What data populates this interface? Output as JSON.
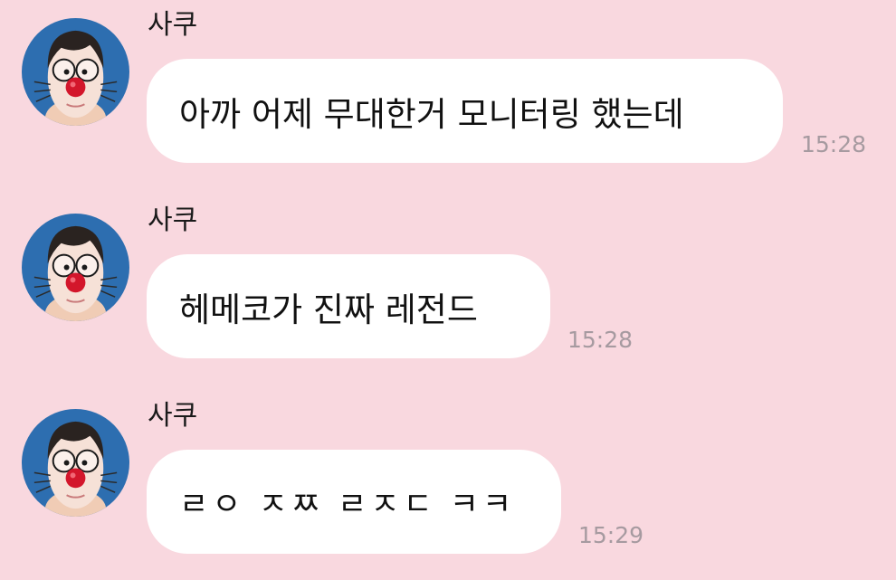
{
  "messages": [
    {
      "sender": "사쿠",
      "text": "아까 어제 무대한거 모니터링 했는데",
      "time": "15:28"
    },
    {
      "sender": "사쿠",
      "text": "헤메코가 진짜 레전드",
      "time": "15:28"
    },
    {
      "sender": "사쿠",
      "text": "ㄹㅇ ㅈㅉ ㄹㅈㄷ ㅋㅋ",
      "time": "15:29"
    }
  ],
  "colors": {
    "background": "#f9d8df",
    "bubble": "#ffffff",
    "timestamp": "#a69aa0",
    "avatar_background": "#2d6eb0"
  },
  "icons": {
    "avatar": "doraemon-filter-profile-photo"
  }
}
